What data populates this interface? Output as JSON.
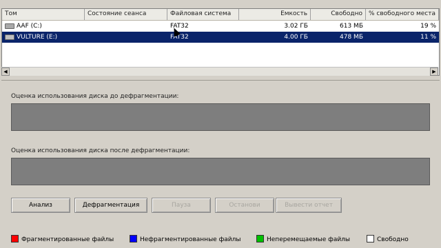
{
  "columns": [
    "Том",
    "Состояние сеанса",
    "Файловая система",
    "Емкость",
    "Свободно",
    "% свободного места"
  ],
  "drives": [
    {
      "icon": "drive-icon",
      "volume": "AAF (C:)",
      "status": "",
      "fs": "FAT32",
      "capacity": "3.02 ГБ",
      "free": "613 МБ",
      "pct": "19 %",
      "selected": false
    },
    {
      "icon": "drive-icon",
      "volume": "VULTURE (E:)",
      "status": "",
      "fs": "FAT32",
      "capacity": "4.00 ГБ",
      "free": "478 МБ",
      "pct": "11 %",
      "selected": true
    }
  ],
  "analysis": {
    "before_label": "Оценка использования диска до дефрагментации:",
    "after_label": "Оценка использования диска после дефрагментации:"
  },
  "buttons": {
    "analyze": "Анализ",
    "defrag": "Дефрагментация",
    "pause": "Пауза",
    "stop": "Останови",
    "report": "Вывести отчет"
  },
  "legend": [
    {
      "label": "Фрагментированные файлы",
      "color": "#ff0000"
    },
    {
      "label": "Нефрагментированные файлы",
      "color": "#0000ff"
    },
    {
      "label": "Неперемещаемые файлы",
      "color": "#00c000"
    },
    {
      "label": "Свободно",
      "color": "#ffffff"
    }
  ],
  "colors": {
    "selection": "#0a246a",
    "window": "#d4d0c8",
    "usage_bar": "#7e7e7e"
  }
}
